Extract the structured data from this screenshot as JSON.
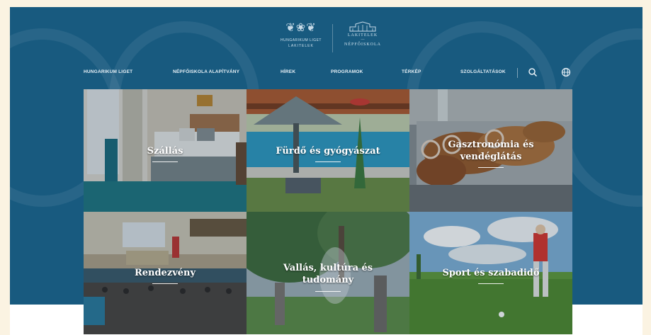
{
  "brand": {
    "logo1_line1": "HUNGARIKUM LIGET",
    "logo1_line2": "LAKITELEK",
    "logo2_line1": "LAKITELEK",
    "logo2_line2": "—",
    "logo2_line3": "NÉPFŐISKOLA"
  },
  "nav": {
    "items": [
      {
        "label": "HUNGARIKUM LIGET"
      },
      {
        "label": "NÉPFŐISKOLA ALAPÍTVÁNY"
      },
      {
        "label": "HÍREK"
      },
      {
        "label": "PROGRAMOK"
      },
      {
        "label": "TÉRKÉP"
      },
      {
        "label": "SZOLGÁLTATÁSOK"
      }
    ],
    "search_icon": "search-icon",
    "globe_icon": "globe-icon"
  },
  "tiles": [
    {
      "lines": [
        "Szállás"
      ]
    },
    {
      "lines": [
        "Fürdő és gyógyászat"
      ]
    },
    {
      "lines": [
        "Gasztronómia és",
        "vendéglátás"
      ]
    },
    {
      "lines": [
        "Rendezvény"
      ]
    },
    {
      "lines": [
        "Vallás, kultúra és",
        "tudomány"
      ]
    },
    {
      "lines": [
        "Sport és szabadidő"
      ]
    }
  ],
  "colors": {
    "hero": "#185a7f",
    "page_bg": "#fbf3e2",
    "nav_text": "#e8f1f7"
  }
}
